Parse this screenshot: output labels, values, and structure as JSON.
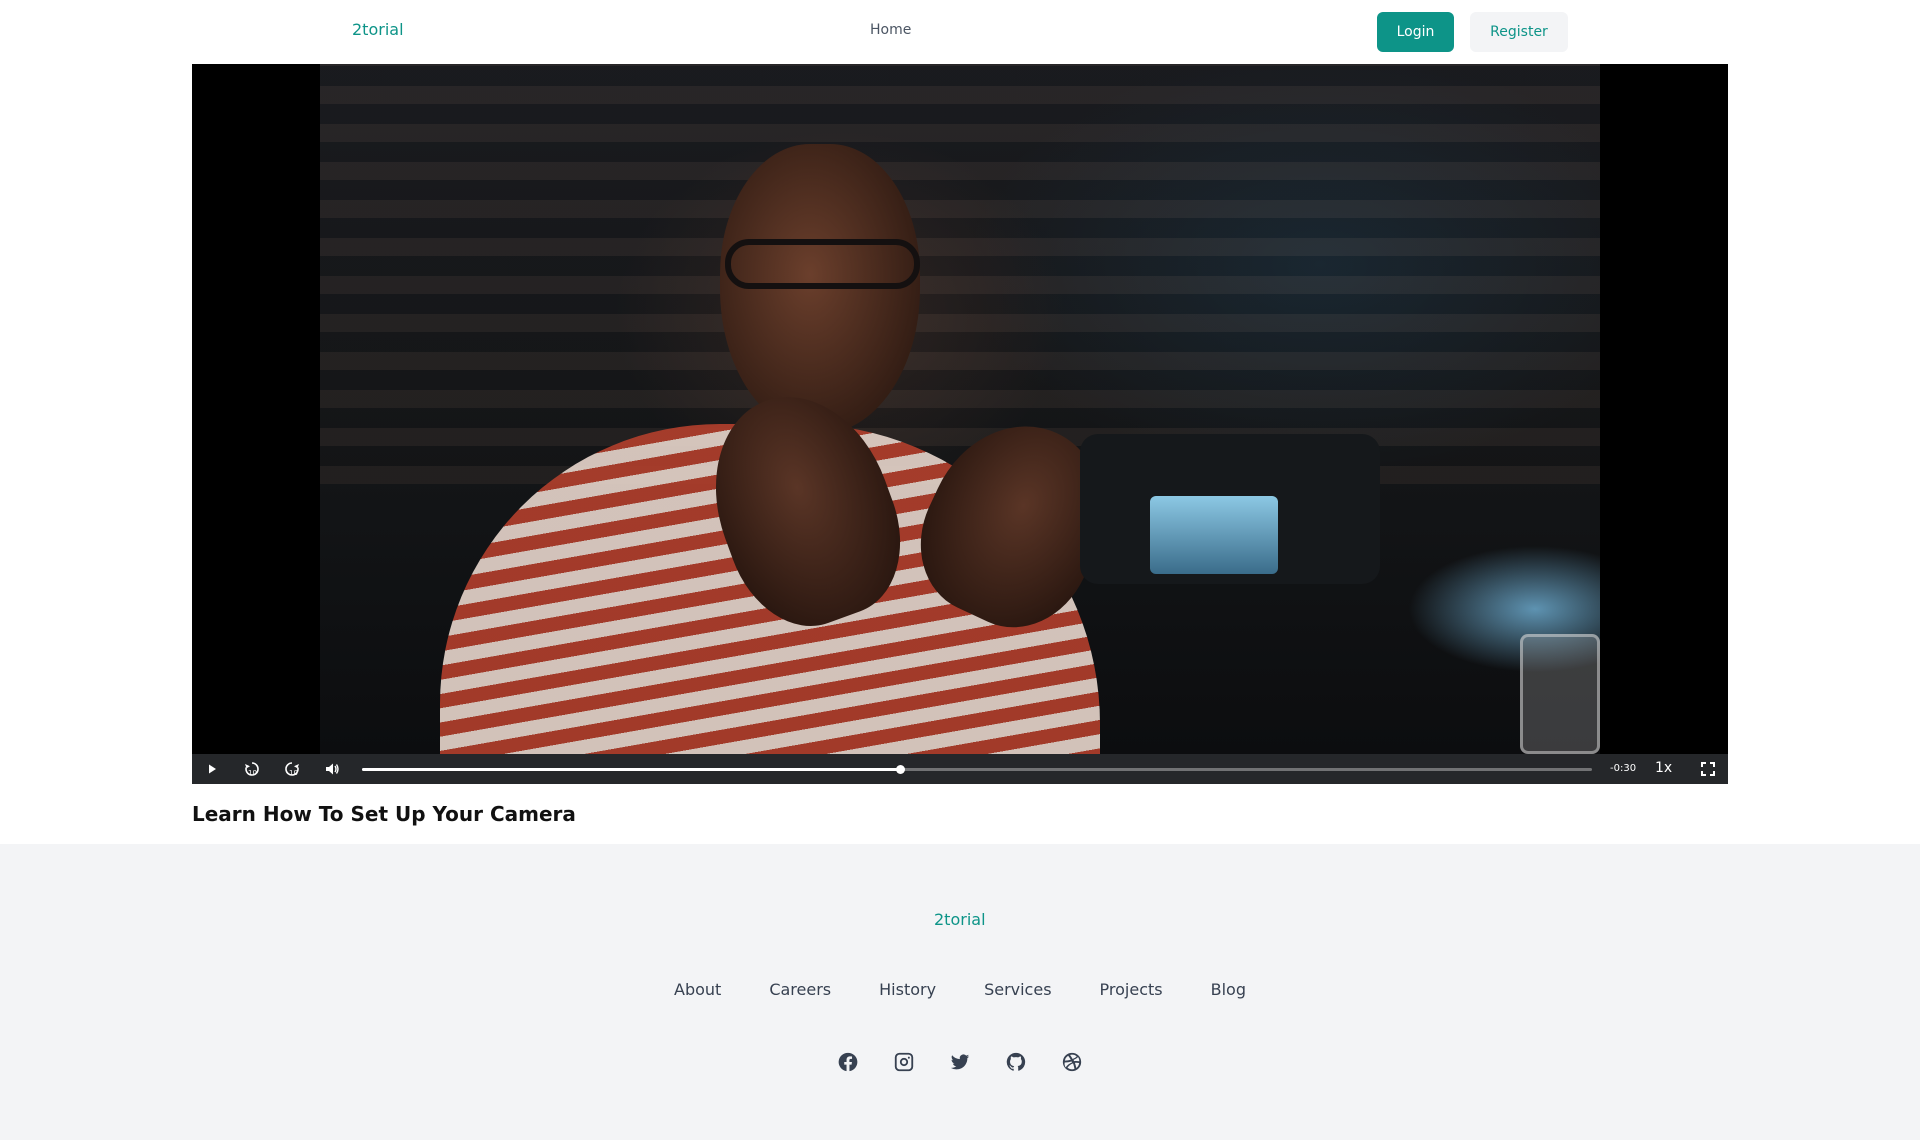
{
  "header": {
    "logo": "2torial",
    "nav_home": "Home",
    "login_label": "Login",
    "register_label": "Register"
  },
  "video": {
    "title": "Learn How To Set Up Your Camera",
    "time_remaining": "-0:30",
    "speed": "1x",
    "progress": 0.437,
    "controls": [
      "play-icon",
      "rewind-10-icon",
      "forward-10-icon",
      "volume-icon",
      "fullscreen-icon"
    ]
  },
  "footer": {
    "logo": "2torial",
    "links": [
      "About",
      "Careers",
      "History",
      "Services",
      "Projects",
      "Blog"
    ],
    "social": [
      "facebook-icon",
      "instagram-icon",
      "twitter-icon",
      "github-icon",
      "dribbble-icon"
    ]
  },
  "colors": {
    "brand": "#0d9488",
    "footer_bg": "#f3f4f6"
  }
}
